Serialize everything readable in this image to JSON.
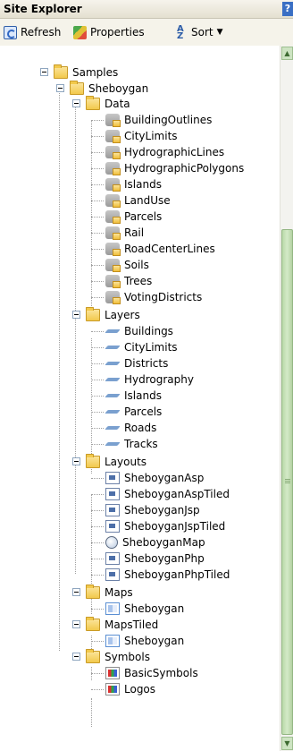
{
  "panel": {
    "title": "Site Explorer",
    "help_glyph": "?"
  },
  "toolbar": {
    "refresh": "Refresh",
    "properties": "Properties",
    "sort": "Sort"
  },
  "tree": {
    "samples": "Samples",
    "sheboygan": "Sheboygan",
    "data": {
      "label": "Data",
      "items": [
        "BuildingOutlines",
        "CityLimits",
        "HydrographicLines",
        "HydrographicPolygons",
        "Islands",
        "LandUse",
        "Parcels",
        "Rail",
        "RoadCenterLines",
        "Soils",
        "Trees",
        "VotingDistricts"
      ]
    },
    "layers": {
      "label": "Layers",
      "items": [
        "Buildings",
        "CityLimits",
        "Districts",
        "Hydrography",
        "Islands",
        "Parcels",
        "Roads",
        "Tracks"
      ]
    },
    "layouts": {
      "label": "Layouts",
      "items": [
        "SheboyganAsp",
        "SheboyganAspTiled",
        "SheboyganJsp",
        "SheboyganJspTiled",
        "SheboyganMap",
        "SheboyganPhp",
        "SheboyganPhpTiled"
      ]
    },
    "maps": {
      "label": "Maps",
      "items": [
        "Sheboygan"
      ]
    },
    "mapstiled": {
      "label": "MapsTiled",
      "items": [
        "Sheboygan"
      ]
    },
    "symbols": {
      "label": "Symbols",
      "items": [
        "BasicSymbols",
        "Logos"
      ]
    }
  }
}
